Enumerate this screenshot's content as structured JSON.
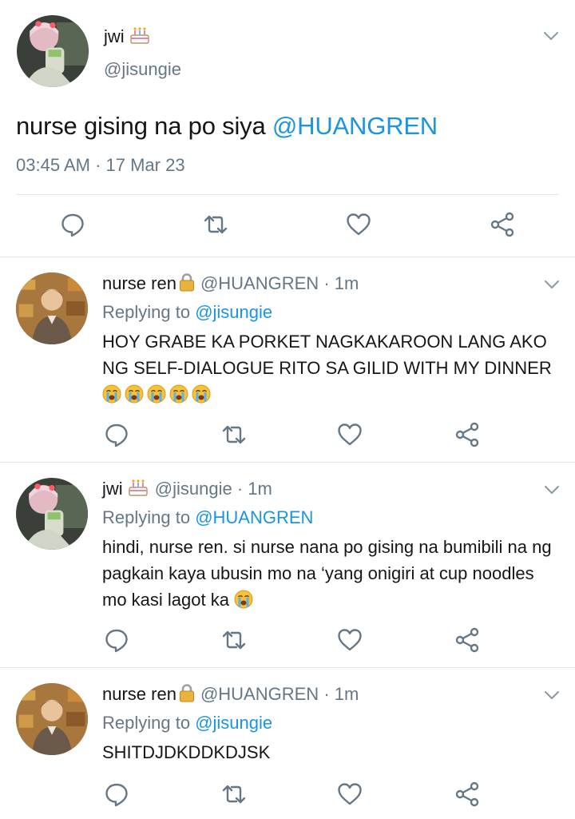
{
  "main_tweet": {
    "display_name": "jwi",
    "name_emoji": "birthday-cake",
    "handle": "@jisungie",
    "text_plain": "nurse gising na po siya ",
    "text_mention": "@HUANGREN",
    "timestamp": "03:45 AM · 17 Mar 23"
  },
  "replies": [
    {
      "display_name": "nurse ren",
      "name_emoji": "lock",
      "handle": "@HUANGREN",
      "time": "· 1m",
      "replying_label": "Replying to ",
      "replying_to": "@jisungie",
      "body": "HOY GRABE KA PORKET NAGKAKAROON LANG AKO NG SELF-DIALOGUE RITO SA GILID WITH MY DINNER",
      "emoji_count": "5"
    },
    {
      "display_name": "jwi",
      "name_emoji": "birthday-cake",
      "handle": "@jisungie",
      "time": "· 1m",
      "replying_label": "Replying to ",
      "replying_to": "@HUANGREN",
      "body": "hindi, nurse ren. si nurse nana po gising na bumibili na ng pagkain kaya ubusin mo na ‘yang onigiri at cup noodles mo kasi lagot ka",
      "emoji_count": "1"
    },
    {
      "display_name": "nurse ren",
      "name_emoji": "lock",
      "handle": "@HUANGREN",
      "time": "· 1m",
      "replying_label": "Replying to ",
      "replying_to": "@jisungie",
      "body": "SHITDJDKDDKDJSK",
      "emoji_count": "0"
    }
  ],
  "icons": {
    "reply": "speech-bubble-icon",
    "retweet": "retweet-icon",
    "like": "heart-icon",
    "share": "share-icon",
    "more": "chevron-down-icon"
  },
  "colors": {
    "link_blue": "#1b95e0",
    "secondary_gray": "#657786",
    "divider": "#e1e8ed"
  }
}
